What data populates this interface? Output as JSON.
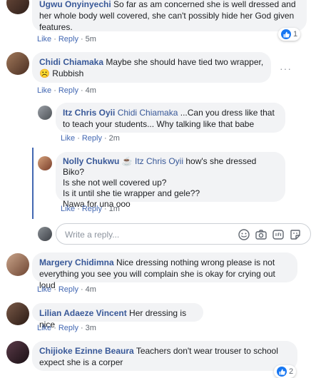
{
  "actions": {
    "like": "Like",
    "reply": "Reply",
    "sep": "·"
  },
  "comments": [
    {
      "author": "Ugwu Onyinyechi",
      "text": "So far as am concerned she is well dressed and her whole body well covered, she can't possibly hide her God given features.",
      "time": "5m",
      "reaction_count": "1"
    },
    {
      "author": "Chidi Chiamaka",
      "text": "Maybe she should have tied two wrapper, ☹️ Rubbish",
      "time": "4m",
      "replies": [
        {
          "author": "Itz Chris Oyii",
          "mention": "Chidi Chiamaka",
          "text": "...Can you dress like that to teach your students... Why talking like that babe",
          "time": "2m"
        },
        {
          "author": "Nolly Chukwu",
          "mention": "Itz Chris Oyii",
          "text_1": "how's she dressed Biko?",
          "text_2": "Is she not well covered up?",
          "text_3": "Is it until she tie wrapper and gele??",
          "text_4": "Nawa for una ooo",
          "time": "1m"
        }
      ],
      "reply_box": {
        "placeholder": "Write a reply..."
      }
    },
    {
      "author": "Margery Chidimna",
      "text": "Nice dressing nothing wrong please is not everything you see you will complain she is okay for crying out loud",
      "time": "4m"
    },
    {
      "author": "Lilian Adaeze Vincent",
      "text": "Her dressing is nice",
      "time": "3m"
    },
    {
      "author": "Chijioke Ezinne Beaura",
      "text": "Teachers don't wear trouser to school expect she is a corper",
      "reaction_count": "2"
    }
  ],
  "colors": {
    "link": "#385898",
    "bubble": "#f2f3f5",
    "like_blue": "#1877f2",
    "meta": "#606770"
  }
}
